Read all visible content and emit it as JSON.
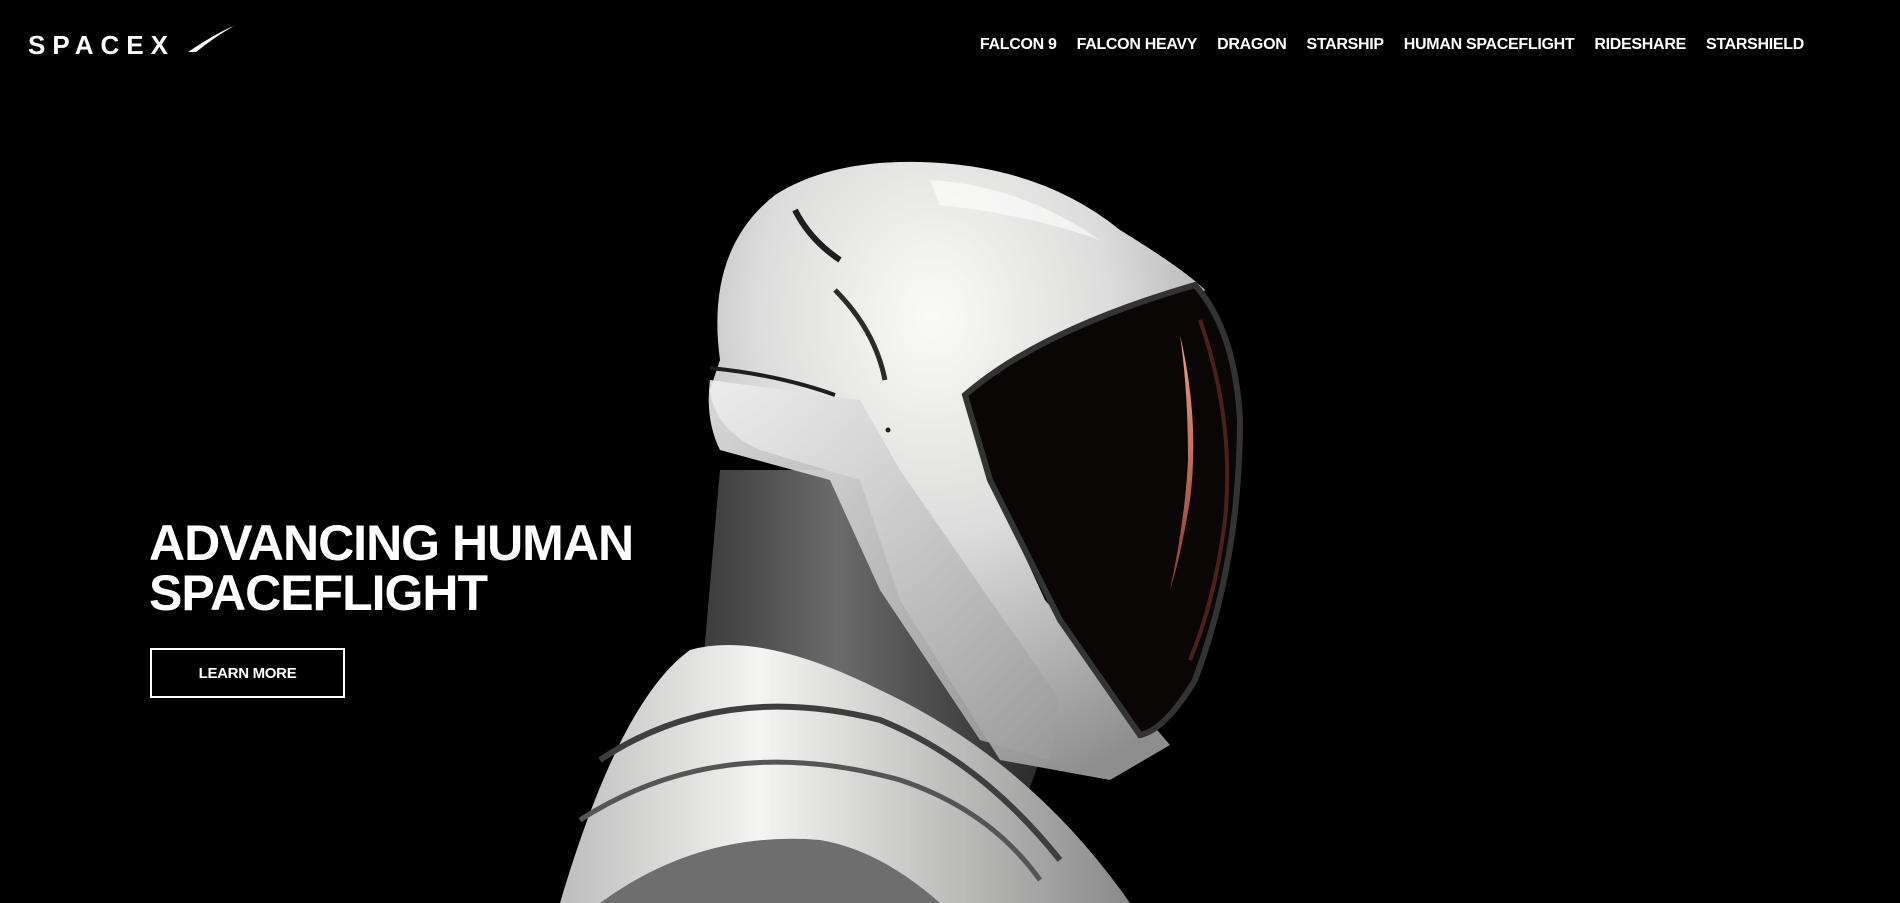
{
  "header": {
    "logo_text": "SPACEX",
    "nav_items": [
      {
        "label": "FALCON 9"
      },
      {
        "label": "FALCON HEAVY"
      },
      {
        "label": "DRAGON"
      },
      {
        "label": "STARSHIP"
      },
      {
        "label": "HUMAN SPACEFLIGHT"
      },
      {
        "label": "RIDESHARE"
      },
      {
        "label": "STARSHIELD"
      }
    ]
  },
  "hero": {
    "title_line1": "ADVANCING HUMAN",
    "title_line2": "SPACEFLIGHT",
    "cta_label": "LEARN MORE",
    "image_subject": "astronaut-helmet-profile"
  },
  "colors": {
    "background": "#000000",
    "text": "#ffffff",
    "suit_white": "#e6e6e6",
    "visor_dark": "#0b0606",
    "visor_glow": "#e08868"
  }
}
